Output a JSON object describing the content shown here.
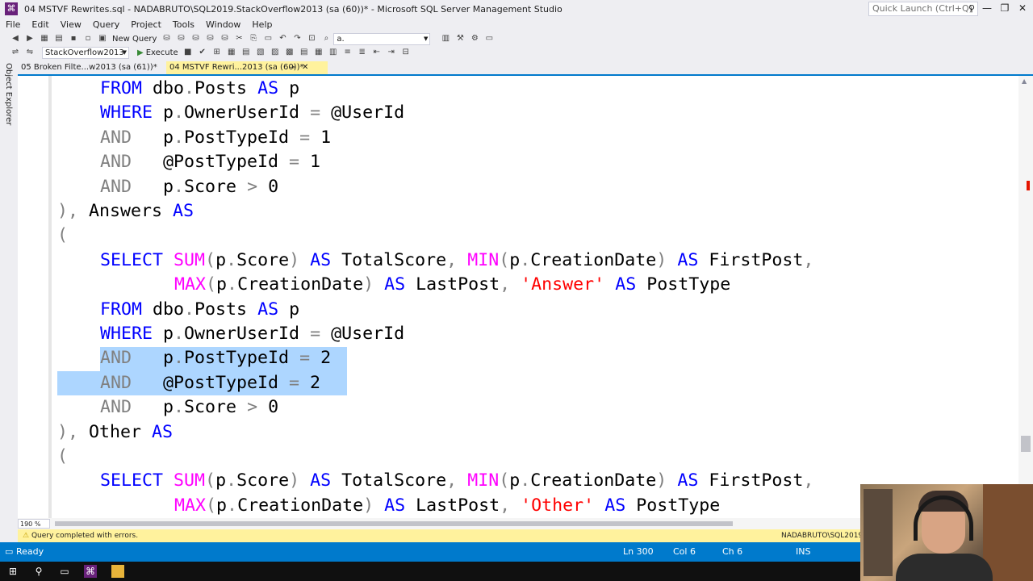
{
  "window": {
    "title": "04 MSTVF Rewrites.sql - NADABRUTO\\SQL2019.StackOverflow2013 (sa (60))* - Microsoft SQL Server Management Studio",
    "quick_launch_placeholder": "Quick Launch (Ctrl+Q)"
  },
  "menu": [
    "File",
    "Edit",
    "View",
    "Query",
    "Project",
    "Tools",
    "Window",
    "Help"
  ],
  "toolbar": {
    "new_query_label": "New Query",
    "find_combo_value": "a.",
    "database_combo_value": "StackOverflow2013",
    "execute_label": "Execute"
  },
  "left_panel": {
    "label": "Object Explorer"
  },
  "tabs": [
    {
      "label": "05 Broken Filte...w2013 (sa (61))*",
      "active": false
    },
    {
      "label": "04 MSTVF Rewri...2013 (sa (60))*",
      "active": true
    }
  ],
  "editor": {
    "zoom": "190 %",
    "lines": [
      [
        [
          "kw",
          "FROM"
        ],
        [
          "id",
          " dbo"
        ],
        [
          "op",
          "."
        ],
        [
          "id",
          "Posts "
        ],
        [
          "kw",
          "AS"
        ],
        [
          "id",
          " p"
        ]
      ],
      [
        [
          "kw",
          "WHERE"
        ],
        [
          "id",
          " p"
        ],
        [
          "op",
          "."
        ],
        [
          "id",
          "OwnerUserId "
        ],
        [
          "op",
          "="
        ],
        [
          "id",
          " @UserId"
        ]
      ],
      [
        [
          "op",
          "AND"
        ],
        [
          "id",
          "   p"
        ],
        [
          "op",
          "."
        ],
        [
          "id",
          "PostTypeId "
        ],
        [
          "op",
          "="
        ],
        [
          "id",
          " 1"
        ]
      ],
      [
        [
          "op",
          "AND"
        ],
        [
          "id",
          "   @PostTypeId "
        ],
        [
          "op",
          "="
        ],
        [
          "id",
          " 1"
        ]
      ],
      [
        [
          "op",
          "AND"
        ],
        [
          "id",
          "   p"
        ],
        [
          "op",
          "."
        ],
        [
          "id",
          "Score "
        ],
        [
          "op",
          ">"
        ],
        [
          "id",
          " 0"
        ]
      ],
      [
        [
          "op",
          "),"
        ],
        [
          "id",
          " Answers "
        ],
        [
          "kw",
          "AS"
        ]
      ],
      [
        [
          "op",
          "("
        ]
      ],
      [
        [
          "kw",
          "SELECT"
        ],
        [
          "id",
          " "
        ],
        [
          "fn",
          "SUM"
        ],
        [
          "op",
          "("
        ],
        [
          "id",
          "p"
        ],
        [
          "op",
          "."
        ],
        [
          "id",
          "Score"
        ],
        [
          "op",
          ")"
        ],
        [
          "id",
          " "
        ],
        [
          "kw",
          "AS"
        ],
        [
          "id",
          " TotalScore"
        ],
        [
          "op",
          ","
        ],
        [
          "id",
          " "
        ],
        [
          "fn",
          "MIN"
        ],
        [
          "op",
          "("
        ],
        [
          "id",
          "p"
        ],
        [
          "op",
          "."
        ],
        [
          "id",
          "CreationDate"
        ],
        [
          "op",
          ")"
        ],
        [
          "id",
          " "
        ],
        [
          "kw",
          "AS"
        ],
        [
          "id",
          " FirstPost"
        ],
        [
          "op",
          ","
        ]
      ],
      [
        [
          "fn",
          "MAX"
        ],
        [
          "op",
          "("
        ],
        [
          "id",
          "p"
        ],
        [
          "op",
          "."
        ],
        [
          "id",
          "CreationDate"
        ],
        [
          "op",
          ")"
        ],
        [
          "id",
          " "
        ],
        [
          "kw",
          "AS"
        ],
        [
          "id",
          " LastPost"
        ],
        [
          "op",
          ","
        ],
        [
          "id",
          " "
        ],
        [
          "str",
          "'Answer'"
        ],
        [
          "id",
          " "
        ],
        [
          "kw",
          "AS"
        ],
        [
          "id",
          " PostType"
        ]
      ],
      [
        [
          "kw",
          "FROM"
        ],
        [
          "id",
          " dbo"
        ],
        [
          "op",
          "."
        ],
        [
          "id",
          "Posts "
        ],
        [
          "kw",
          "AS"
        ],
        [
          "id",
          " p"
        ]
      ],
      [
        [
          "kw",
          "WHERE"
        ],
        [
          "id",
          " p"
        ],
        [
          "op",
          "."
        ],
        [
          "id",
          "OwnerUserId "
        ],
        [
          "op",
          "="
        ],
        [
          "id",
          " @UserId"
        ]
      ],
      [
        [
          "op",
          "AND"
        ],
        [
          "id",
          "   p"
        ],
        [
          "op",
          "."
        ],
        [
          "id",
          "PostTypeId "
        ],
        [
          "op",
          "="
        ],
        [
          "id",
          " 2"
        ]
      ],
      [
        [
          "op",
          "AND"
        ],
        [
          "id",
          "   @PostTypeId "
        ],
        [
          "op",
          "="
        ],
        [
          "id",
          " 2"
        ]
      ],
      [
        [
          "op",
          "AND"
        ],
        [
          "id",
          "   p"
        ],
        [
          "op",
          "."
        ],
        [
          "id",
          "Score "
        ],
        [
          "op",
          ">"
        ],
        [
          "id",
          " 0"
        ]
      ],
      [
        [
          "op",
          "),"
        ],
        [
          "id",
          " Other "
        ],
        [
          "kw",
          "AS"
        ]
      ],
      [
        [
          "op",
          "("
        ]
      ],
      [
        [
          "kw",
          "SELECT"
        ],
        [
          "id",
          " "
        ],
        [
          "fn",
          "SUM"
        ],
        [
          "op",
          "("
        ],
        [
          "id",
          "p"
        ],
        [
          "op",
          "."
        ],
        [
          "id",
          "Score"
        ],
        [
          "op",
          ")"
        ],
        [
          "id",
          " "
        ],
        [
          "kw",
          "AS"
        ],
        [
          "id",
          " TotalScore"
        ],
        [
          "op",
          ","
        ],
        [
          "id",
          " "
        ],
        [
          "fn",
          "MIN"
        ],
        [
          "op",
          "("
        ],
        [
          "id",
          "p"
        ],
        [
          "op",
          "."
        ],
        [
          "id",
          "CreationDate"
        ],
        [
          "op",
          ")"
        ],
        [
          "id",
          " "
        ],
        [
          "kw",
          "AS"
        ],
        [
          "id",
          " FirstPost"
        ],
        [
          "op",
          ","
        ]
      ],
      [
        [
          "fn",
          "MAX"
        ],
        [
          "op",
          "("
        ],
        [
          "id",
          "p"
        ],
        [
          "op",
          "."
        ],
        [
          "id",
          "CreationDate"
        ],
        [
          "op",
          ")"
        ],
        [
          "id",
          " "
        ],
        [
          "kw",
          "AS"
        ],
        [
          "id",
          " LastPost"
        ],
        [
          "op",
          ","
        ],
        [
          "id",
          " "
        ],
        [
          "str",
          "'Other'"
        ],
        [
          "id",
          " "
        ],
        [
          "kw",
          "AS"
        ],
        [
          "id",
          " PostType"
        ]
      ]
    ]
  },
  "query_status": {
    "message": "Query completed with errors.",
    "server": "NADABRUTO\\SQL2019 (15.0..."
  },
  "status_bar": {
    "ready": "Ready",
    "line": "Ln 300",
    "col": "Col 6",
    "ch": "Ch 6",
    "mode": "INS"
  },
  "colors": {
    "accent": "#007ACC",
    "keyword": "#0000FF",
    "function": "#FF00FF",
    "string": "#FF0000",
    "operator": "#808080",
    "selection": "#ADD6FF",
    "tab_active": "#FFF29D"
  }
}
